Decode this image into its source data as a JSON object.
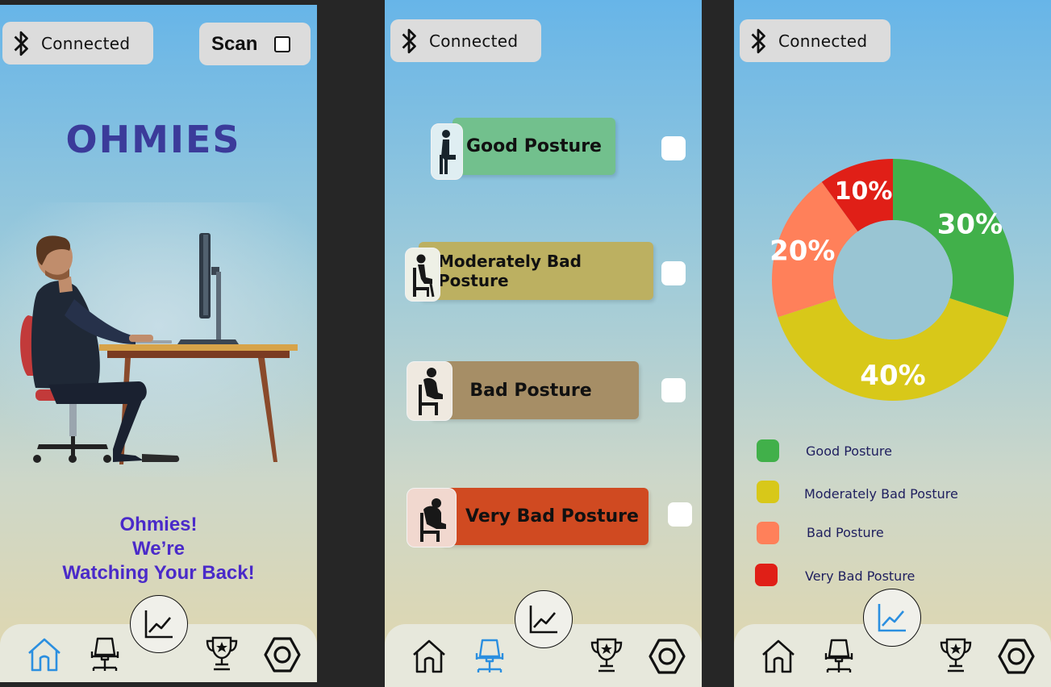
{
  "colors": {
    "good": "#41b04a",
    "moderate": "#d8c819",
    "bad": "#ff805a",
    "very_bad": "#e01f17",
    "active_nav": "#2b8fe0",
    "brand": "#3b3b9a",
    "tagline": "#4a2ac9"
  },
  "screen_home": {
    "connection_status": "Connected",
    "scan_label": "Scan",
    "scan_checked": false,
    "brand_title": "OHMIES",
    "tagline": [
      "Ohmies!",
      "We’re",
      "Watching Your Back!"
    ],
    "active_tab": "home"
  },
  "screen_posture": {
    "connection_status": "Connected",
    "postures": [
      {
        "label": "Good Posture",
        "color": "#72c08d",
        "checked": false
      },
      {
        "label": "Moderately Bad Posture",
        "color": "#bcb061",
        "checked": false
      },
      {
        "label": "Bad Posture",
        "color": "#a68e66",
        "checked": false
      },
      {
        "label": "Very Bad Posture",
        "color": "#d04a21",
        "checked": false
      }
    ],
    "active_tab": "posture"
  },
  "screen_stats": {
    "connection_status": "Connected",
    "active_tab": "stats"
  },
  "chart_data": {
    "type": "pie",
    "categories": [
      "Good Posture",
      "Moderately Bad Posture",
      "Bad Posture",
      "Very Bad Posture"
    ],
    "values": [
      30,
      40,
      20,
      10
    ],
    "labels": [
      "30%",
      "40%",
      "20%",
      "10%"
    ],
    "colors": [
      "#41b04a",
      "#d8c819",
      "#ff805a",
      "#e01f17"
    ],
    "donut": true,
    "legend_position": "bottom-left"
  },
  "nav_icons": [
    "home-icon",
    "chair-icon",
    "chart-icon",
    "trophy-icon",
    "settings-icon"
  ]
}
